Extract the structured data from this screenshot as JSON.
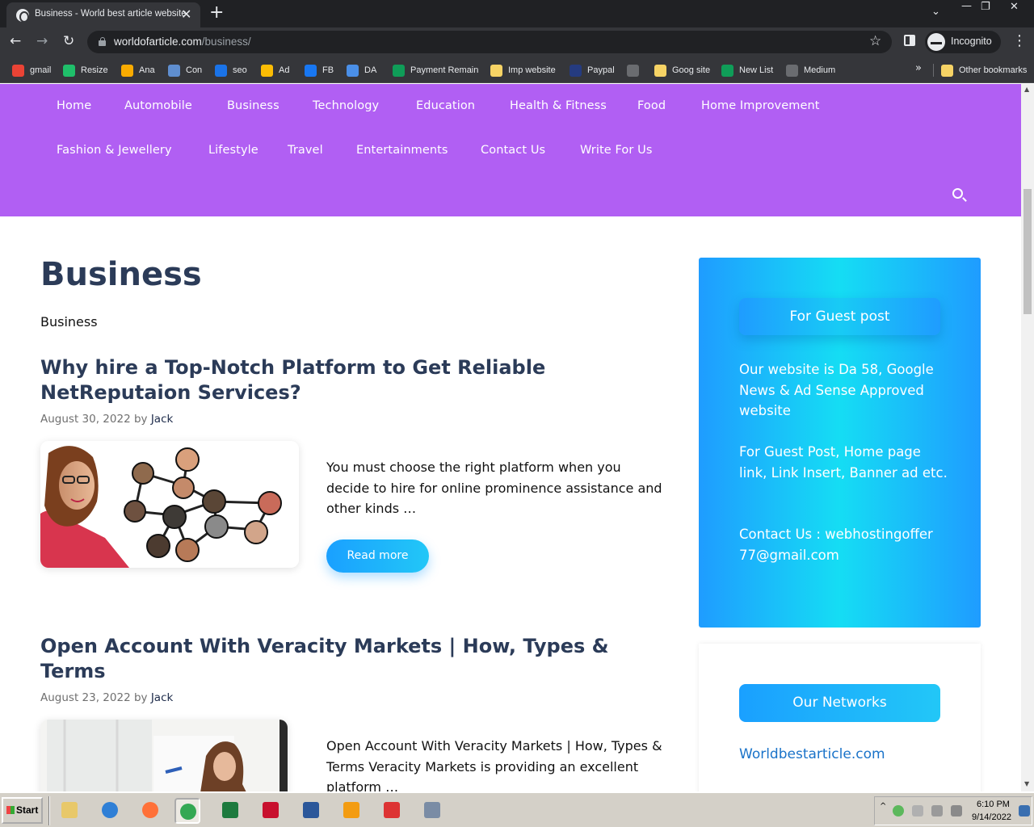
{
  "browser": {
    "tab_title": "Business - World best article website",
    "tab_close": "✕",
    "new_tab": "+",
    "url_host": "worldofarticle.com",
    "url_path": "/business/",
    "profile_label": "Incognito",
    "window_minimize": "—",
    "window_restore": "❐",
    "window_close": "✕",
    "tab_search": "⌄",
    "back": "←",
    "forward": "→",
    "reload": "↻",
    "star": "☆",
    "menu": "⋮"
  },
  "bookmarks": {
    "items": [
      {
        "label": "gmail",
        "icon": "gmail-icon",
        "color": "#ea4335"
      },
      {
        "label": "Resize",
        "icon": "resize-icon",
        "color": "#1fbf6a"
      },
      {
        "label": "Ana",
        "icon": "analytics-icon",
        "color": "#f9ab00"
      },
      {
        "label": "Con",
        "icon": "car-icon",
        "color": "#5f8ecf"
      },
      {
        "label": "seo",
        "icon": "seo-icon",
        "color": "#1a73e8"
      },
      {
        "label": "Ad",
        "icon": "google-ads-icon",
        "color": "#fbbc04"
      },
      {
        "label": "FB",
        "icon": "facebook-icon",
        "color": "#1877f2"
      },
      {
        "label": "DA",
        "icon": "link-icon",
        "color": "#4a8fe8"
      },
      {
        "label": "Payment Remain",
        "icon": "sheets-icon",
        "color": "#0f9d58"
      },
      {
        "label": "Imp website",
        "icon": "folder-icon",
        "color": "#f6d365"
      },
      {
        "label": "Paypal",
        "icon": "paypal-icon",
        "color": "#253b80"
      },
      {
        "label": "",
        "icon": "globe-icon",
        "color": "#6a6c70"
      },
      {
        "label": "Goog site",
        "icon": "folder-icon",
        "color": "#f6d365"
      },
      {
        "label": "New List",
        "icon": "sheets-icon",
        "color": "#0f9d58"
      },
      {
        "label": "Medium",
        "icon": "globe-icon",
        "color": "#6a6c70"
      }
    ],
    "more": "»",
    "other": "Other bookmarks"
  },
  "nav": {
    "row1": [
      "Home",
      "Automobile",
      "Business",
      "Technology",
      "Education",
      "Health & Fitness",
      "Food",
      "Home Improvement"
    ],
    "row2": [
      "Fashion & Jewellery",
      "Lifestyle",
      "Travel",
      "Entertainments",
      "Contact Us",
      "Write For Us"
    ]
  },
  "archive": {
    "title": "Business",
    "description": "Business"
  },
  "posts": [
    {
      "title": "Why hire a Top-Notch Platform to Get Reliable NetReputaion Services?",
      "date": "August 30, 2022",
      "by": "by",
      "author": "Jack",
      "excerpt": "You must choose the right platform when you decide to hire for online prominence assistance and other kinds …",
      "read_more": "Read more"
    },
    {
      "title": " Open Account With Veracity Markets  | How, Types & Terms",
      "date": "August 23, 2022",
      "by": "by",
      "author": "Jack",
      "excerpt": " Open Account With Veracity Markets  | How, Types & Terms    Veracity Markets is providing an excellent platform …"
    }
  ],
  "sidebar": {
    "guest_button": "For Guest post",
    "text1": "Our website is Da 58, Google News & Ad Sense Approved website",
    "text2": "For Guest Post, Home page link, Link Insert, Banner ad etc.",
    "text3": "Contact Us : webhostingoffer77@gmail.com",
    "networks_button": "Our Networks",
    "network_link": "Worldbestarticle.com"
  },
  "taskbar": {
    "start": "Start",
    "apps": [
      {
        "icon": "file-explorer-icon",
        "color": "#e8c86a"
      },
      {
        "icon": "internet-explorer-icon",
        "color": "#2f7fd6"
      },
      {
        "icon": "firefox-icon",
        "color": "#ff7139"
      },
      {
        "icon": "chrome-icon",
        "color": "#34a853",
        "active": true
      },
      {
        "icon": "excel-icon",
        "color": "#1d7a3e"
      },
      {
        "icon": "acrobat-icon",
        "color": "#c8102e"
      },
      {
        "icon": "word-icon",
        "color": "#2b579a"
      },
      {
        "icon": "media-player-icon",
        "color": "#f39c12"
      },
      {
        "icon": "snipping-tool-icon",
        "color": "#d33"
      },
      {
        "icon": "calculator-icon",
        "color": "#7a8ca5"
      }
    ],
    "tray_up": "^",
    "time": "6:10 PM",
    "date": "9/14/2022"
  }
}
